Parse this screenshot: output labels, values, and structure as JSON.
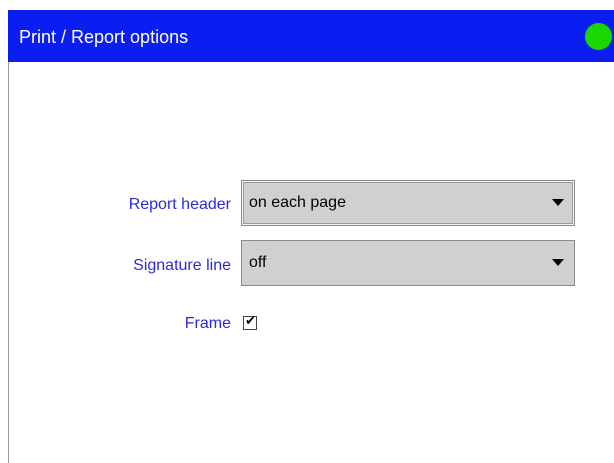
{
  "window": {
    "title": "Print / Report options",
    "status_color": "#19d700",
    "titlebar_color": "#0b1ef2"
  },
  "fields": {
    "report_header": {
      "label": "Report header",
      "value": "on each page"
    },
    "signature_line": {
      "label": "Signature line",
      "value": "off"
    },
    "frame": {
      "label": "Frame",
      "checked": true,
      "mark": "✔"
    }
  },
  "icons": {
    "status": "status-dot-icon",
    "dropdown": "chevron-down-icon",
    "checkbox": "checkbox-checked-icon"
  }
}
